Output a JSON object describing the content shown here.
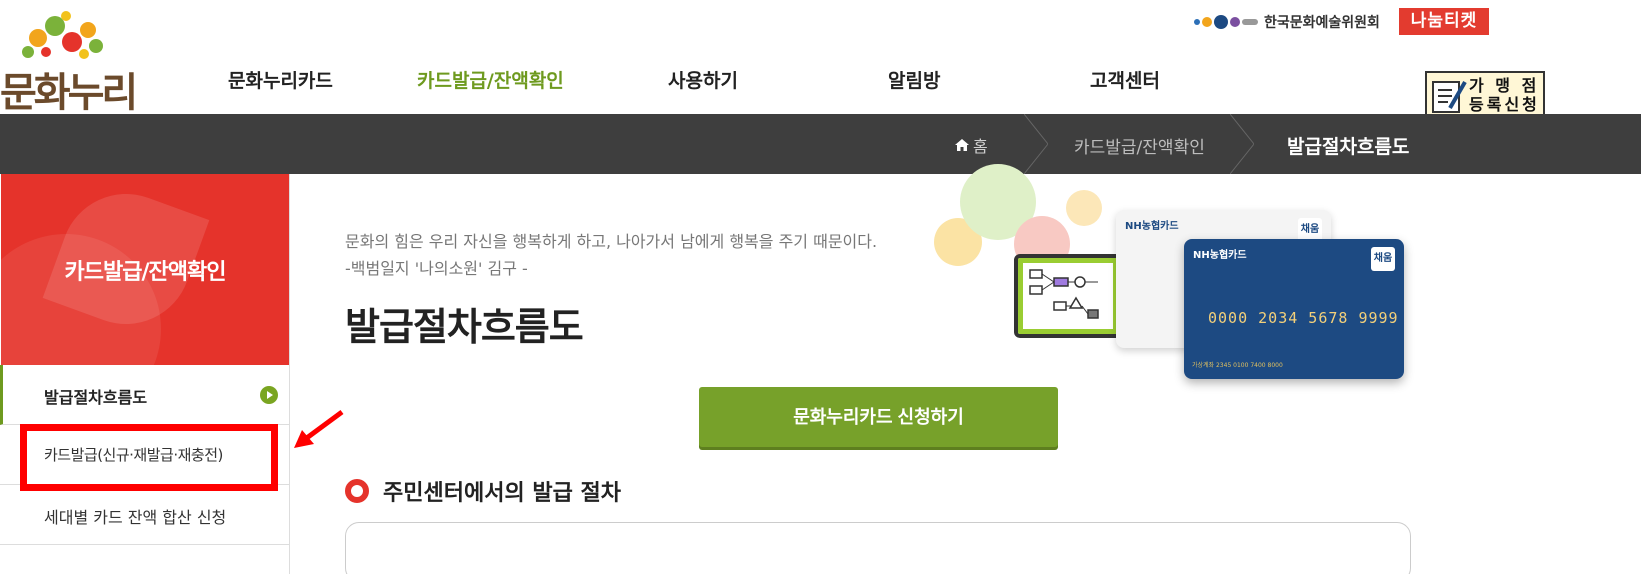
{
  "header": {
    "logo_text": "문화누리",
    "nav": [
      {
        "label": "문화누리카드",
        "active": false
      },
      {
        "label": "카드발급/잔액확인",
        "active": true
      },
      {
        "label": "사용하기",
        "active": false
      },
      {
        "label": "알림방",
        "active": false
      },
      {
        "label": "고객센터",
        "active": false
      }
    ],
    "partner_arko": "한국문화예술위원회",
    "partner_ticket": "나눔티켓",
    "merchant_button": {
      "line1": "가 맹 점",
      "line2": "등록신청"
    }
  },
  "breadcrumb": {
    "home": "홈",
    "section": "카드발급/잔액확인",
    "current": "발급절차흐름도"
  },
  "sidebar": {
    "title": "카드발급/잔액확인",
    "items": [
      {
        "label": "발급절차흐름도",
        "active": true
      },
      {
        "label": "카드발급(신규·재발급·재충전)",
        "active": false
      },
      {
        "label": "세대별 카드 잔액 합산 신청",
        "active": false
      }
    ]
  },
  "main": {
    "quote_line1": "문화의 힘은 우리 자신을 행복하게 하고, 나아가서 남에게 행복을 주기 때문이다.",
    "quote_line2": "-백범일지 '나의소원' 김구 -",
    "title": "발급절차흐름도",
    "apply_button": "문화누리카드 신청하기",
    "section_title": "주민센터에서의 발급 절차"
  },
  "illustration": {
    "card_brand": "NH농협카드",
    "card_badge": "채움",
    "card_number": "0000 2034 5678 9999",
    "card_account": "가상계좌 2345 0100 7400 8000"
  },
  "colors": {
    "accent_green": "#77a12a",
    "nav_active": "#6e9a1f",
    "sidebar_red": "#e5332b",
    "breadcrumb_bar": "#3e3e3e",
    "highlight_red": "#ff0000"
  },
  "icons": [
    "home-icon",
    "chevron-separator-icon",
    "arrow-circle-right-icon",
    "section-ring-icon",
    "monitor-flowchart-icon",
    "pencil-document-icon"
  ]
}
